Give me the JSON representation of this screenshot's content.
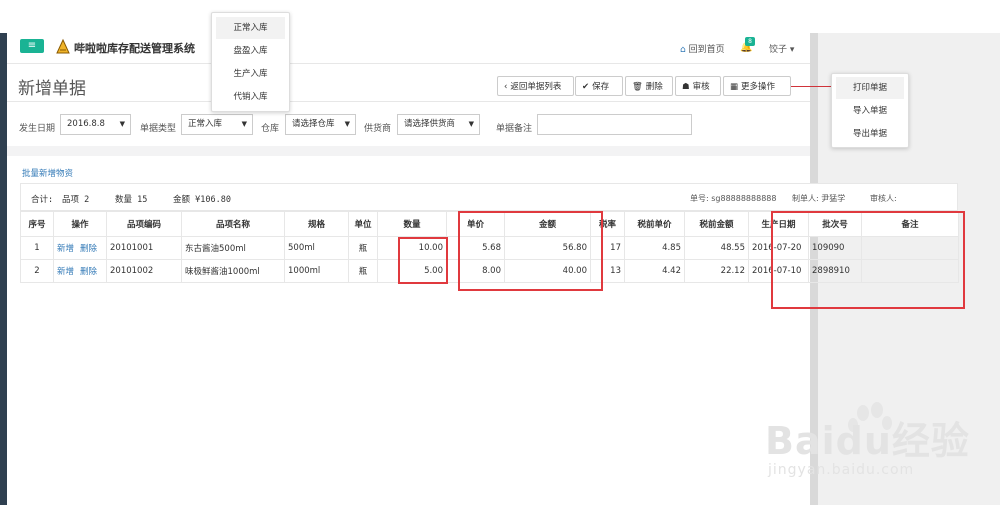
{
  "header": {
    "app_title": "哔啦啦库存配送管理系统",
    "home_label": "回到首页",
    "notification_count": "8",
    "user_name": "饺子"
  },
  "page": {
    "title": "新增单据"
  },
  "toolbar": {
    "back_label": "返回单据列表",
    "save_label": "保存",
    "delete_label": "删除",
    "audit_label": "审核",
    "more_label": "更多操作"
  },
  "filters": {
    "date_label": "发生日期",
    "date_value": "2016.8.8",
    "type_label": "单据类型",
    "type_value": "正常入库",
    "warehouse_label": "仓库",
    "warehouse_value": "请选择仓库",
    "supplier_label": "供货商",
    "supplier_value": "请选择供货商",
    "remark_label": "单据备注",
    "remark_value": ""
  },
  "type_dropdown": {
    "options": [
      "正常入库",
      "盘盈入库",
      "生产入库",
      "代销入库"
    ]
  },
  "more_dropdown": {
    "options": [
      "打印单据",
      "导入单据",
      "导出单据"
    ]
  },
  "batch_add_label": "批量新增物资",
  "summary": {
    "total_label": "合计:",
    "items_text": "品项 2",
    "qty_text": "数量 15",
    "amount_text": "金额 ¥106.80",
    "doc_no_text": "单号: sg88888888888",
    "maker_text": "制单人: 尹猛学",
    "auditor_text": "审核人:"
  },
  "table": {
    "columns": [
      "序号",
      "操作",
      "品项编码",
      "品项名称",
      "规格",
      "单位",
      "数量",
      "单价",
      "金额",
      "税率",
      "税前单价",
      "税前金额",
      "生产日期",
      "批次号",
      "备注"
    ],
    "add_label": "新增",
    "del_label": "删除",
    "rows": [
      {
        "no": "1",
        "code": "20101001",
        "name": "东古酱油500ml",
        "spec": "500ml",
        "unit": "瓶",
        "qty": "10.00",
        "price": "5.68",
        "amount": "56.80",
        "tax": "17",
        "pre_price": "4.85",
        "pre_amount": "48.55",
        "date": "2016-07-20",
        "batch": "109090",
        "remark": ""
      },
      {
        "no": "2",
        "code": "20101002",
        "name": "味极鲜酱油1000ml",
        "spec": "1000ml",
        "unit": "瓶",
        "qty": "5.00",
        "price": "8.00",
        "amount": "40.00",
        "tax": "13",
        "pre_price": "4.42",
        "pre_amount": "22.12",
        "date": "2016-07-10",
        "batch": "2898910",
        "remark": ""
      }
    ]
  },
  "watermark": {
    "brand": "Baidu经验",
    "url": "jingyan.baidu.com"
  },
  "colors": {
    "accent": "#1ab394",
    "link": "#337ab7",
    "highlight_red": "#e0393e",
    "sidebar": "#2f4050"
  }
}
